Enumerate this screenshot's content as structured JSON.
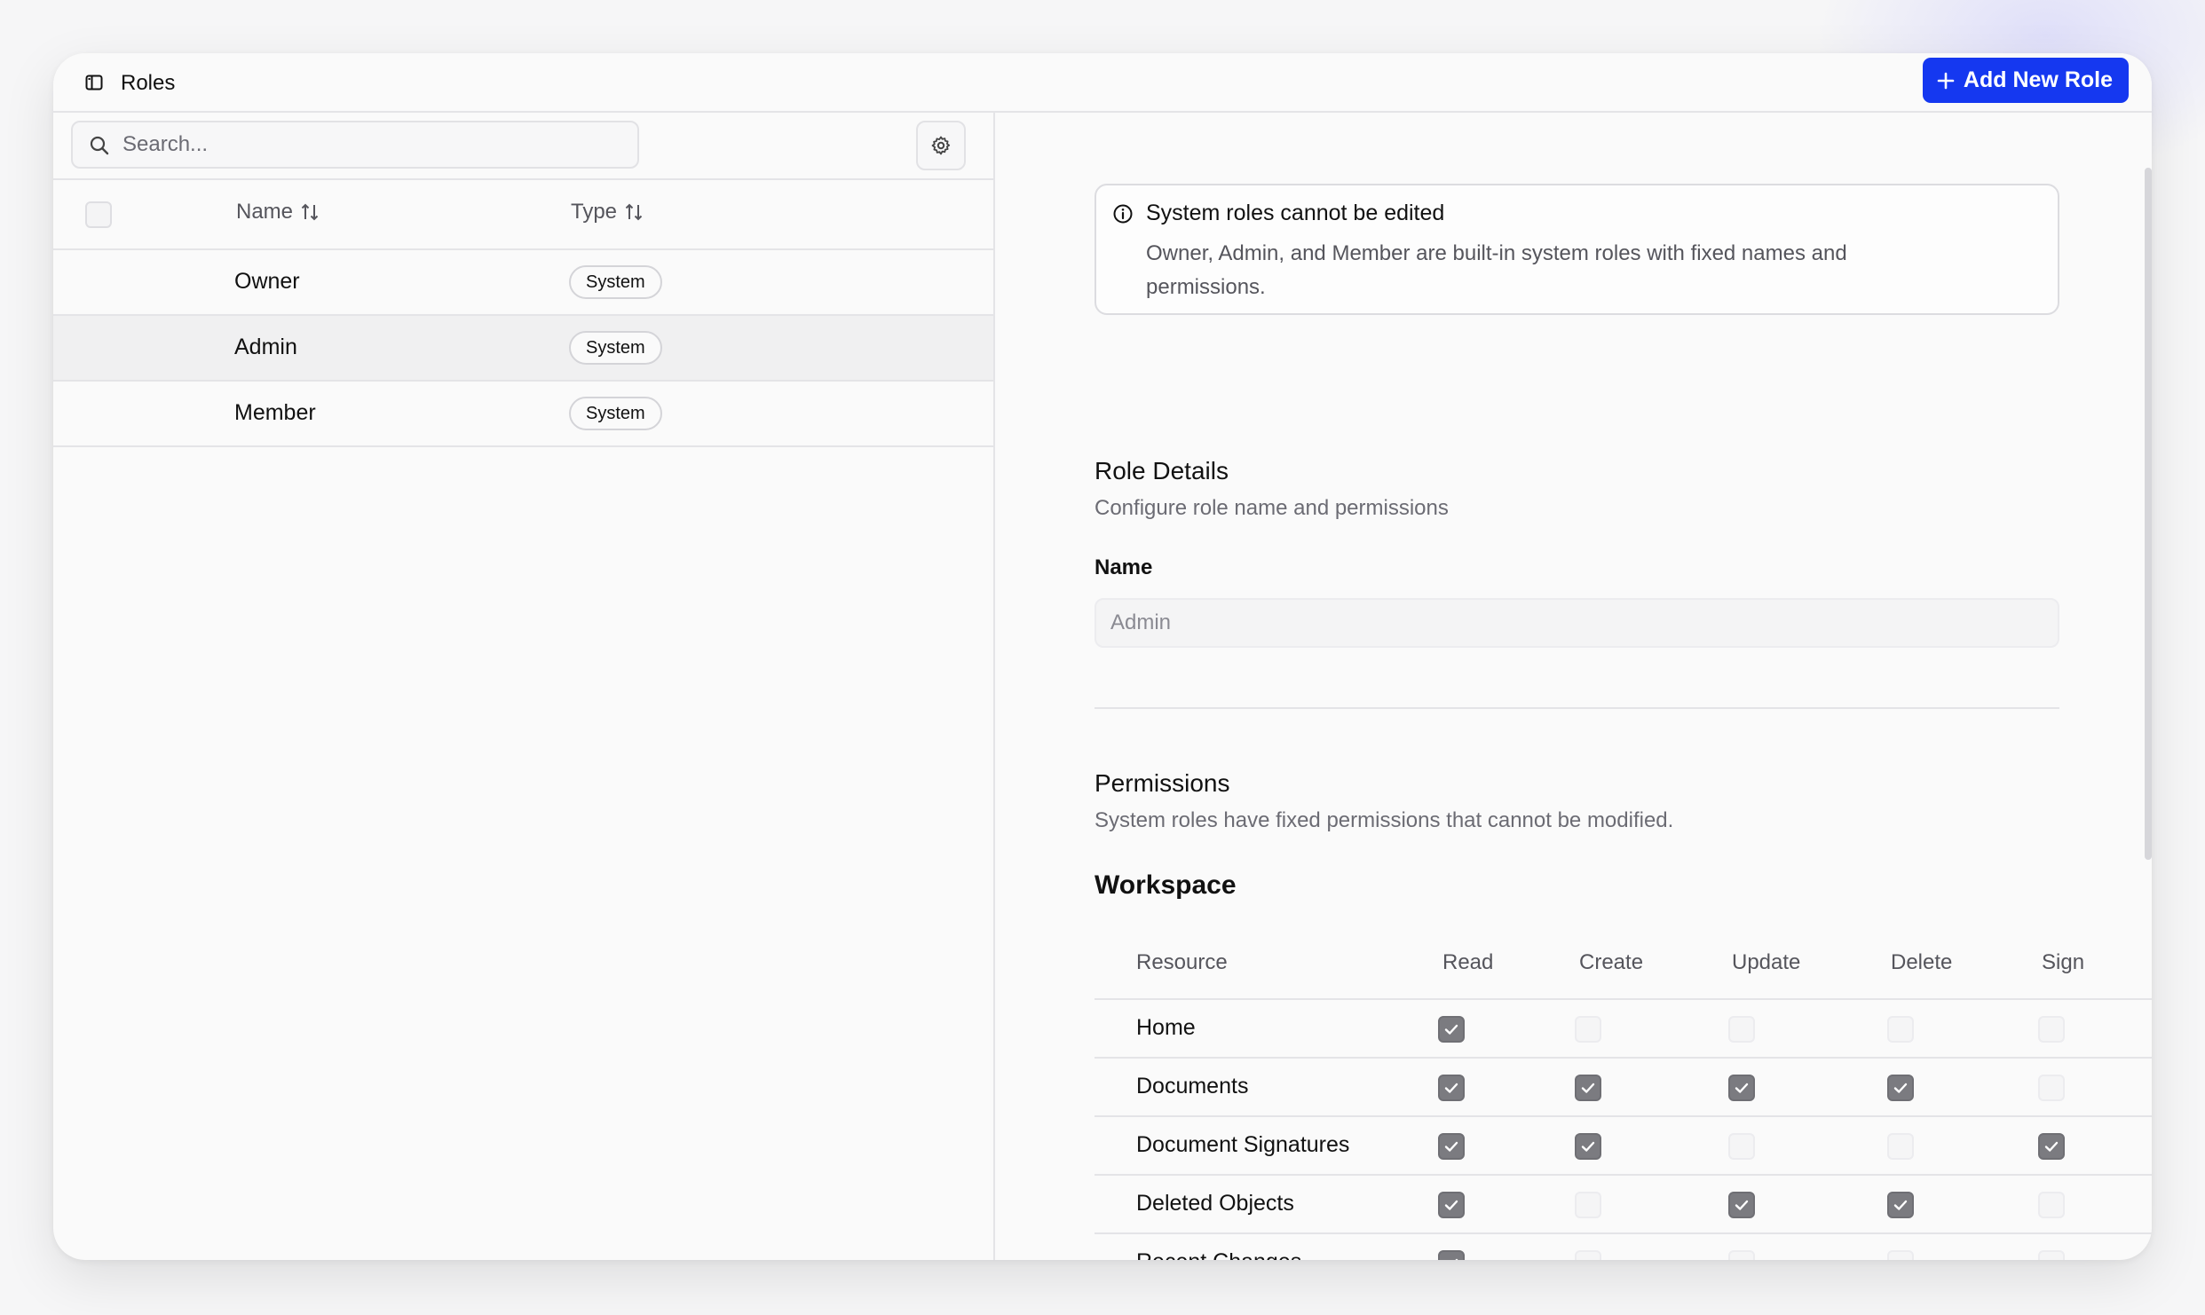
{
  "topbar": {
    "title": "Roles",
    "add_button_label": "Add New Role"
  },
  "search": {
    "placeholder": "Search...",
    "value": ""
  },
  "roles_table": {
    "columns": [
      "Name",
      "Type"
    ],
    "rows": [
      {
        "name": "Owner",
        "type": "System",
        "selected": false
      },
      {
        "name": "Admin",
        "type": "System",
        "selected": true
      },
      {
        "name": "Member",
        "type": "System",
        "selected": false
      }
    ]
  },
  "alert": {
    "title": "System roles cannot be edited",
    "description": "Owner, Admin, and Member are built-in system roles with fixed names and permissions."
  },
  "role_details": {
    "title": "Role Details",
    "subtitle": "Configure role name and permissions",
    "name_label": "Name",
    "name_placeholder": "Admin"
  },
  "permissions": {
    "title": "Permissions",
    "subtitle": "System roles have fixed permissions that cannot be modified.",
    "group_title": "Workspace",
    "columns": [
      "Resource",
      "Read",
      "Create",
      "Update",
      "Delete",
      "Sign"
    ],
    "rows": [
      {
        "resource": "Home",
        "checks": [
          true,
          false,
          false,
          false,
          false
        ]
      },
      {
        "resource": "Documents",
        "checks": [
          true,
          true,
          true,
          true,
          false
        ]
      },
      {
        "resource": "Document Signatures",
        "checks": [
          true,
          true,
          false,
          false,
          true
        ]
      },
      {
        "resource": "Deleted Objects",
        "checks": [
          true,
          false,
          true,
          true,
          false
        ]
      },
      {
        "resource": "Recent Changes",
        "checks": [
          true,
          false,
          false,
          false,
          false
        ]
      }
    ]
  },
  "colors": {
    "accent": "#1538f0",
    "checked": "#7b7b80"
  }
}
